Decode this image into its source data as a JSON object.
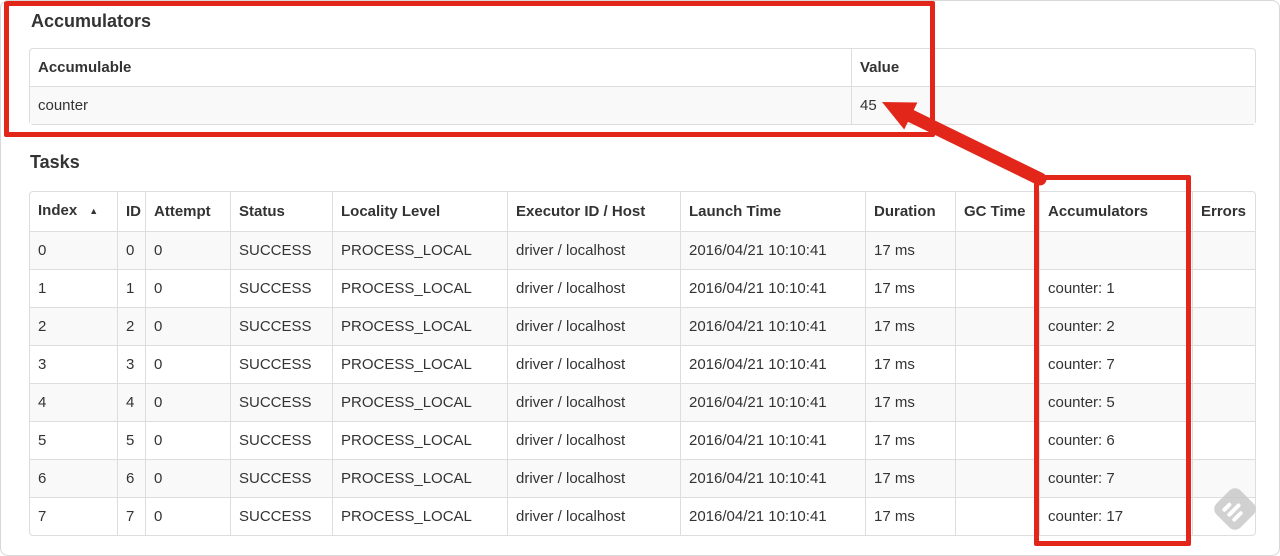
{
  "annotations": {
    "color": "#e3261a",
    "arrow_target_value": "45"
  },
  "accumulators": {
    "title": "Accumulators",
    "headers": [
      "Accumulable",
      "Value"
    ],
    "rows": [
      [
        "counter",
        "45"
      ]
    ]
  },
  "tasks": {
    "title": "Tasks",
    "sort_icon": "▲",
    "sorted_by": "Index",
    "headers": [
      "Index",
      "ID",
      "Attempt",
      "Status",
      "Locality Level",
      "Executor ID / Host",
      "Launch Time",
      "Duration",
      "GC Time",
      "Accumulators",
      "Errors"
    ],
    "rows": [
      [
        "0",
        "0",
        "0",
        "SUCCESS",
        "PROCESS_LOCAL",
        "driver / localhost",
        "2016/04/21 10:10:41",
        "17 ms",
        "",
        "",
        ""
      ],
      [
        "1",
        "1",
        "0",
        "SUCCESS",
        "PROCESS_LOCAL",
        "driver / localhost",
        "2016/04/21 10:10:41",
        "17 ms",
        "",
        "counter: 1",
        ""
      ],
      [
        "2",
        "2",
        "0",
        "SUCCESS",
        "PROCESS_LOCAL",
        "driver / localhost",
        "2016/04/21 10:10:41",
        "17 ms",
        "",
        "counter: 2",
        ""
      ],
      [
        "3",
        "3",
        "0",
        "SUCCESS",
        "PROCESS_LOCAL",
        "driver / localhost",
        "2016/04/21 10:10:41",
        "17 ms",
        "",
        "counter: 7",
        ""
      ],
      [
        "4",
        "4",
        "0",
        "SUCCESS",
        "PROCESS_LOCAL",
        "driver / localhost",
        "2016/04/21 10:10:41",
        "17 ms",
        "",
        "counter: 5",
        ""
      ],
      [
        "5",
        "5",
        "0",
        "SUCCESS",
        "PROCESS_LOCAL",
        "driver / localhost",
        "2016/04/21 10:10:41",
        "17 ms",
        "",
        "counter: 6",
        ""
      ],
      [
        "6",
        "6",
        "0",
        "SUCCESS",
        "PROCESS_LOCAL",
        "driver / localhost",
        "2016/04/21 10:10:41",
        "17 ms",
        "",
        "counter: 7",
        ""
      ],
      [
        "7",
        "7",
        "0",
        "SUCCESS",
        "PROCESS_LOCAL",
        "driver / localhost",
        "2016/04/21 10:10:41",
        "17 ms",
        "",
        "counter: 17",
        ""
      ]
    ]
  }
}
